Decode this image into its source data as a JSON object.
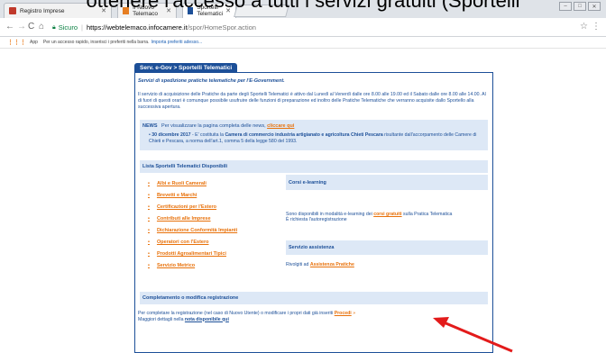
{
  "overlay": {
    "caption": "ottenere l'accesso a tutti i servizi gratuiti (Sportelli"
  },
  "browser": {
    "tabs": [
      {
        "label": "Registro Imprese"
      },
      {
        "label": "Il Nuovo Telemaco"
      },
      {
        "label": "Sportelli Telematici"
      }
    ],
    "secure_label": "Sicuro",
    "url_host": "https://webtelemaco.infocamere.it",
    "url_path": "/spor/HomeSpor.action",
    "apps_label": "App",
    "bookmarks_hint": "Per un accesso rapido, inserisci i preferiti nella barra.",
    "bookmarks_link": "Importa preferiti adesso..."
  },
  "page": {
    "tab_label": "Serv. e-Gov > Sportelli Telematici",
    "intro_title": "Servizi di spedizione pratiche telematiche per l'E-Government.",
    "intro_text": "Il servizio di acquisizione delle Pratiche da parte degli Sportelli Telematici è attivo dal Lunedì al Venerdì dalle ore 8.00 alle 19.00 ed il Sabato dalle ore 8.00 alle 14.00. Al di fuori di questi orari è comunque possibile usufruire delle funzioni di preparazione ed inoltro delle Pratiche Telematiche che verranno acquisite dallo Sportello alla successiva apertura.",
    "news": {
      "tag": "NEWS",
      "intro": "Per visualizzare la pagina completa delle news,",
      "link": "cliccare qui",
      "item_date": "30 dicembre 2017",
      "item_mid": " - E' costituita la ",
      "item_bold": "Camera di commercio industria artigianato e agricoltura Chieti Pescara",
      "item_rest": " risultante dall'accorpamento delle Camere di Chieti e Pescara, a norma dell'art.1, comma 5 della legge 580 del 1993."
    },
    "lista": {
      "title": "Lista Sportelli Telematici Disponibili",
      "items": [
        "Albi e Ruoli Camerali",
        "Brevetti e Marchi",
        "Certificazioni per l'Estero",
        "Contributi alle Imprese",
        "Dichiarazione Conformità Impianti",
        "Operatori con l'Estero",
        "Prodotti Agroalimentari Tipici",
        "Servizio Metrico"
      ]
    },
    "elearning": {
      "title": "Corsi e-learning",
      "text_before": "Sono disponibili in modalità e-learning dei ",
      "link": "corsi gratuiti",
      "text_after": " sulla Pratica Telematica",
      "note": "È richiesta l'autoregistrazione"
    },
    "assistenza": {
      "title": "Servizio assistenza",
      "text": "Rivolgiti ad ",
      "link": "Assistenza Pratiche"
    },
    "completamento": {
      "title": "Completamento o modifica registrazione",
      "text": "Per completare la registrazione (nel caso di Nuovo Utente) o modificare i propri dati già inseriti",
      "link": "Procedi",
      "arrow": "»",
      "more": "Maggiori dettagli nella ",
      "more_link": "nota disponibile qui"
    }
  }
}
